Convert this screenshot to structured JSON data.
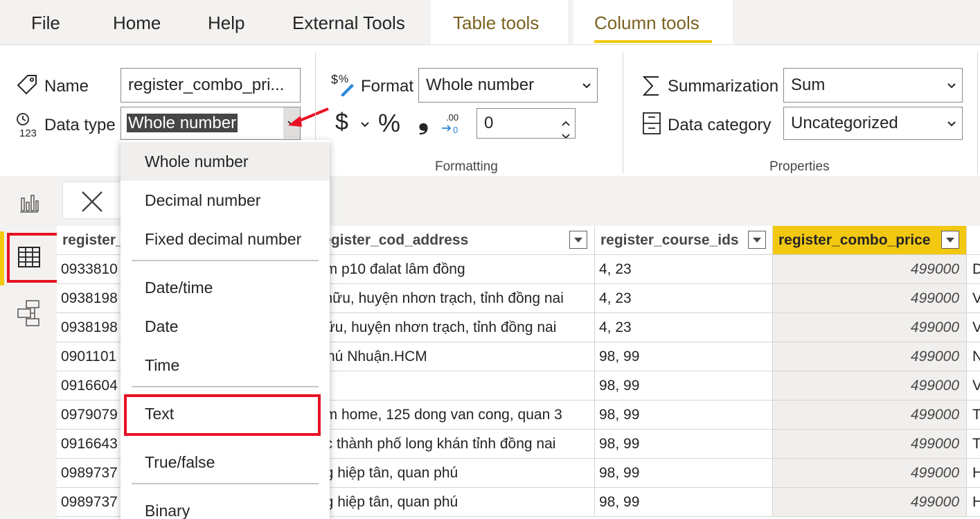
{
  "menu": {
    "file": "File",
    "home": "Home",
    "help": "Help",
    "external_tools": "External Tools",
    "table_tools": "Table tools",
    "column_tools": "Column tools"
  },
  "ribbon": {
    "name_label": "Name",
    "name_value": "register_combo_pri...",
    "datatype_label": "Data type",
    "datatype_value": "Whole number",
    "format_label": "Format",
    "format_value": "Whole number",
    "currency_symbol": "$",
    "percent_symbol": "%",
    "comma_symbol": "❟",
    "decimals_value": "0",
    "formatting_group": "Formatting",
    "summarization_label": "Summarization",
    "summarization_value": "Sum",
    "datacategory_label": "Data category",
    "datacategory_value": "Uncategorized",
    "properties_group": "Properties"
  },
  "dropdown": {
    "items": [
      "Whole number",
      "Decimal number",
      "Fixed decimal number",
      "Date/time",
      "Date",
      "Time",
      "Text",
      "True/false",
      "Binary"
    ],
    "selected": "Whole number"
  },
  "table": {
    "columns": [
      "register_",
      "register_cod_address",
      "register_course_ids",
      "register_combo_price"
    ],
    "rows": [
      [
        "0933810",
        "ám p10 đalat  lâm đồng",
        "4, 23",
        "499000",
        "D"
      ],
      [
        "0938198",
        "i hữu,  huyện nhơn trạch, tỉnh đồng nai",
        "4, 23",
        "499000",
        "V"
      ],
      [
        "0938198",
        "hữu, huyện nhơn trạch, tỉnh đồng nai",
        "4, 23",
        "499000",
        "V"
      ],
      [
        "0901101",
        "Phú Nhuận.HCM",
        "98, 99",
        "499000",
        "N"
      ],
      [
        "0916604",
        "",
        "98, 99",
        "499000",
        "V"
      ],
      [
        "0979079",
        "um home, 125 dong van cong, quan 3",
        "98, 99",
        "499000",
        "T"
      ],
      [
        "0916643",
        "ộc thành phố long khán tỉnh đồng nai",
        "98, 99",
        "499000",
        "T"
      ],
      [
        "0989737",
        "ng  hiệp  tân, quan phú",
        "98, 99",
        "499000",
        "H"
      ],
      [
        "0989737",
        "ng  hiệp  tân, quan phú",
        "98, 99",
        "499000",
        "H"
      ]
    ]
  },
  "colors": {
    "accent": "#f2c811",
    "highlight": "#e81123",
    "ribbon_bg": "#ffffff",
    "chrome_bg": "#f3f2f1"
  }
}
